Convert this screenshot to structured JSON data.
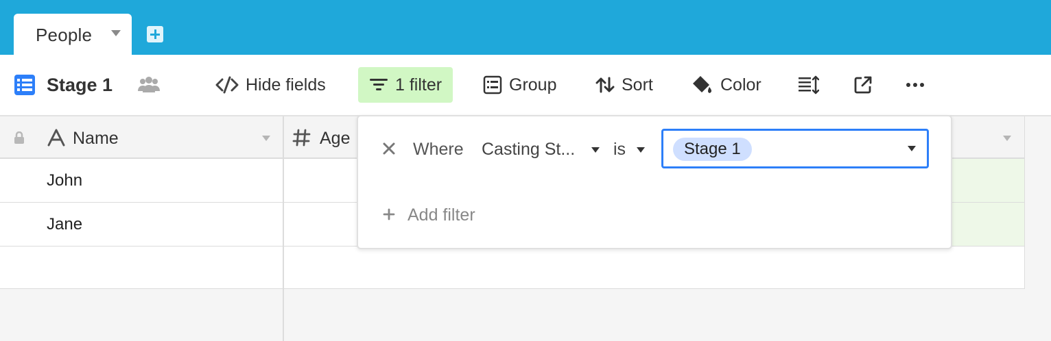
{
  "tabs": {
    "active_table": "People"
  },
  "toolbar": {
    "view_name": "Stage 1",
    "hide_fields": "Hide fields",
    "filter": "1 filter",
    "group": "Group",
    "sort": "Sort",
    "color": "Color"
  },
  "grid": {
    "columns": [
      "Name",
      "Age"
    ],
    "rows": [
      {
        "name": "John"
      },
      {
        "name": "Jane"
      }
    ]
  },
  "filter_popover": {
    "where_label": "Where",
    "field": "Casting St...",
    "operator": "is",
    "value": "Stage 1",
    "add_filter": "Add filter"
  },
  "colors": {
    "tabbar": "#1fa8da",
    "filter_active_bg": "#d1f7c4",
    "value_border": "#2d7ff9",
    "value_chip": "#cfdfff",
    "row_highlight": "#eef8e8"
  }
}
